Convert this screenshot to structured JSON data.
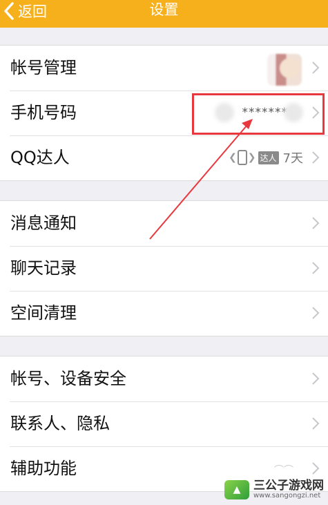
{
  "nav": {
    "back_label": "返回",
    "title": "设置",
    "bg_color": "#f6b01c"
  },
  "groups": [
    {
      "items": [
        {
          "label": "帐号管理",
          "accessory": "avatar"
        },
        {
          "label": "手机号码",
          "value": "*******"
        },
        {
          "label": "QQ达人",
          "badge_text": "达人",
          "days": "7天"
        }
      ]
    },
    {
      "items": [
        {
          "label": "消息通知"
        },
        {
          "label": "聊天记录"
        },
        {
          "label": "空间清理"
        }
      ]
    },
    {
      "items": [
        {
          "label": "帐号、设备安全"
        },
        {
          "label": "联系人、隐私"
        },
        {
          "label": "辅助功能"
        }
      ]
    }
  ],
  "annotation": {
    "color": "#e8383d"
  },
  "watermark": {
    "title": "三公子游戏网",
    "url": "www.sangongzi.net"
  },
  "icons": {
    "back": "chevron-left-icon",
    "row": "chevron-right-icon",
    "badge": "phone-badge-icon"
  }
}
